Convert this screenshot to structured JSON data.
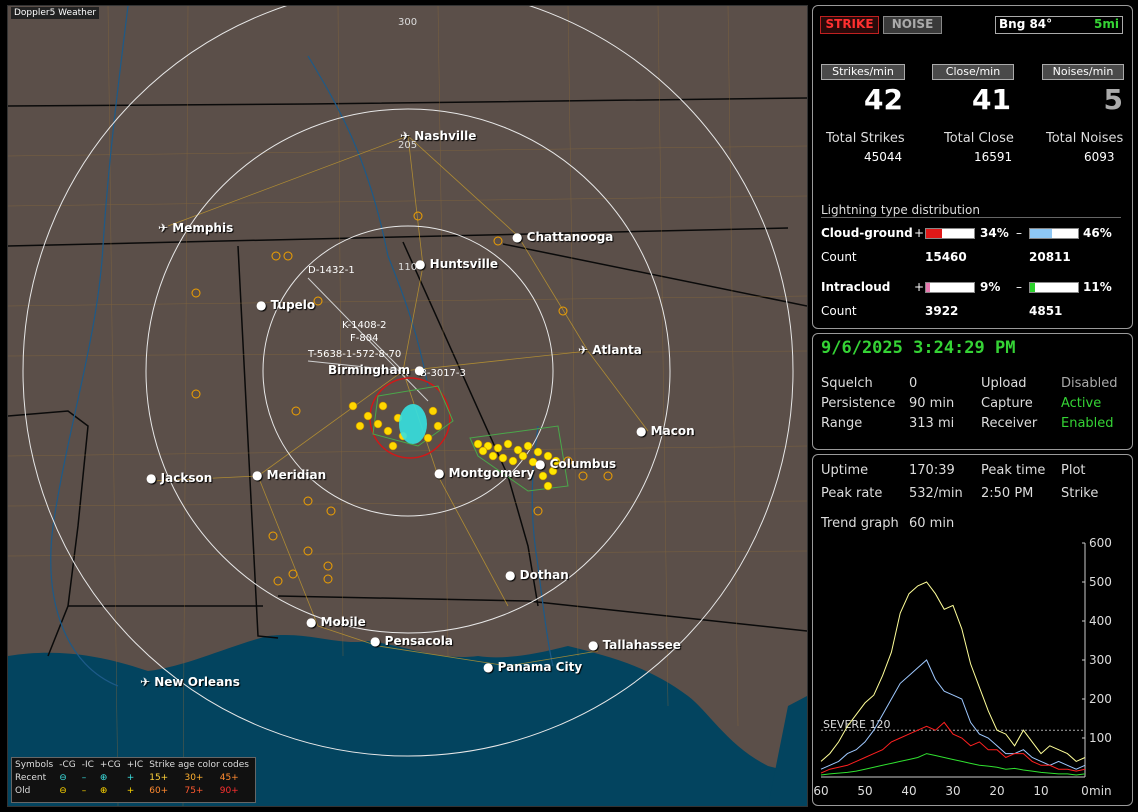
{
  "app": {
    "title": "Doppler5 Weather"
  },
  "map": {
    "ring_labels": [
      "300",
      "205",
      "110"
    ],
    "cities": [
      {
        "name": "Nashville",
        "icon": "airport-icon"
      },
      {
        "name": "Memphis",
        "icon": "airport-icon"
      },
      {
        "name": "Chattanooga",
        "icon": "city-dot-icon"
      },
      {
        "name": "Huntsville",
        "icon": "city-dot-icon"
      },
      {
        "name": "Tupelo",
        "icon": "city-dot-icon"
      },
      {
        "name": "Atlanta",
        "icon": "airport-icon"
      },
      {
        "name": "Birmingham",
        "icon": "city-dot-icon"
      },
      {
        "name": "Macon",
        "icon": "city-dot-icon"
      },
      {
        "name": "Jackson",
        "icon": "city-dot-icon"
      },
      {
        "name": "Meridian",
        "icon": "city-dot-icon"
      },
      {
        "name": "Montgomery",
        "icon": "city-dot-icon"
      },
      {
        "name": "Columbus",
        "icon": "city-dot-icon"
      },
      {
        "name": "Dothan",
        "icon": "city-dot-icon"
      },
      {
        "name": "Mobile",
        "icon": "city-dot-icon"
      },
      {
        "name": "Pensacola",
        "icon": "city-dot-icon"
      },
      {
        "name": "Tallahassee",
        "icon": "city-dot-icon"
      },
      {
        "name": "Panama City",
        "icon": "city-dot-icon"
      },
      {
        "name": "New Orleans",
        "icon": "airport-icon"
      }
    ],
    "sensors": [
      "D-1432-1",
      "K-1408-2",
      "F-804",
      "T-5638-1-572-8-70",
      "B-3017-3"
    ],
    "legend": {
      "header": [
        "Symbols",
        "-CG",
        "-IC",
        "+CG",
        "+IC",
        "Strike age color codes"
      ],
      "recent": {
        "label": "Recent",
        "ages": [
          "15+",
          "30+",
          "45+"
        ]
      },
      "old": {
        "label": "Old",
        "ages": [
          "60+",
          "75+",
          "90+"
        ]
      }
    }
  },
  "stats": {
    "strike_button": "STRIKE",
    "noise_button": "NOISE",
    "bearing": "Bng 84°",
    "range": "5mi",
    "strikes_min_label": "Strikes/min",
    "close_min_label": "Close/min",
    "noises_min_label": "Noises/min",
    "strikes_min": "42",
    "close_min": "41",
    "noises_min": "5",
    "total_strikes_label": "Total Strikes",
    "total_close_label": "Total Close",
    "total_noises_label": "Total Noises",
    "total_strikes": "45044",
    "total_close": "16591",
    "total_noises": "6093",
    "dist_title": "Lightning type distribution",
    "cg_label": "Cloud-ground",
    "ic_label": "Intracloud",
    "count_label": "Count",
    "plus": "+",
    "minus": "–",
    "cg_plus_pct": "34%",
    "cg_minus_pct": "46%",
    "cg_plus_count": "15460",
    "cg_minus_count": "20811",
    "ic_plus_pct": "9%",
    "ic_minus_pct": "11%",
    "ic_plus_count": "3922",
    "ic_minus_count": "4851",
    "cg_plus_fill": 0.34,
    "cg_minus_fill": 0.46,
    "ic_plus_fill": 0.09,
    "ic_minus_fill": 0.11,
    "colors": {
      "cg_plus": "#e01818",
      "cg_minus": "#8ec8f5",
      "ic_plus": "#e87ab0",
      "ic_minus": "#2bd12b"
    }
  },
  "status": {
    "datetime": "9/6/2025 3:24:29 PM",
    "squelch_label": "Squelch",
    "squelch": "0",
    "persistence_label": "Persistence",
    "persistence": "90 min",
    "range_label": "Range",
    "range": "313 mi",
    "upload_label": "Upload",
    "upload": "Disabled",
    "capture_label": "Capture",
    "capture": "Active",
    "receiver_label": "Receiver",
    "receiver": "Enabled"
  },
  "trend": {
    "uptime_label": "Uptime",
    "uptime": "170:39",
    "peak_time_label": "Peak time",
    "peak_time": "2:50 PM",
    "plot_label": "Plot",
    "peak_rate_label": "Peak rate",
    "peak_rate": "532/min",
    "plot_value": "Strike",
    "trend_label": "Trend graph",
    "trend_value": "60 min",
    "severe_label": "SEVERE 120"
  },
  "chart_data": {
    "type": "line",
    "x": [
      60,
      58,
      56,
      54,
      52,
      50,
      48,
      46,
      44,
      42,
      40,
      38,
      36,
      34,
      32,
      30,
      28,
      26,
      24,
      22,
      20,
      18,
      16,
      14,
      12,
      10,
      8,
      6,
      4,
      2,
      0
    ],
    "series": [
      {
        "name": "",
        "color": "#ffff99",
        "values": [
          40,
          60,
          90,
          130,
          160,
          190,
          210,
          260,
          320,
          420,
          470,
          490,
          500,
          470,
          430,
          440,
          380,
          290,
          230,
          170,
          120,
          110,
          80,
          120,
          90,
          60,
          80,
          70,
          60,
          40,
          50
        ]
      },
      {
        "name": "",
        "color": "#9ec8ff",
        "values": [
          20,
          30,
          40,
          60,
          70,
          90,
          120,
          160,
          200,
          240,
          260,
          280,
          300,
          250,
          220,
          210,
          200,
          140,
          110,
          100,
          80,
          60,
          60,
          70,
          50,
          40,
          30,
          40,
          30,
          20,
          30
        ]
      },
      {
        "name": "",
        "color": "#ff2020",
        "values": [
          10,
          20,
          25,
          30,
          40,
          50,
          60,
          70,
          90,
          100,
          110,
          120,
          130,
          120,
          140,
          110,
          100,
          80,
          90,
          70,
          70,
          50,
          60,
          60,
          40,
          30,
          30,
          20,
          20,
          15,
          20
        ]
      },
      {
        "name": "",
        "color": "#30e030",
        "values": [
          5,
          8,
          10,
          12,
          15,
          20,
          25,
          30,
          35,
          40,
          45,
          50,
          60,
          55,
          50,
          45,
          40,
          35,
          30,
          28,
          25,
          20,
          22,
          18,
          15,
          12,
          10,
          8,
          8,
          5,
          8
        ]
      }
    ],
    "severe_threshold": 120,
    "ylim": [
      0,
      600
    ],
    "yticks": [
      "100",
      "200",
      "300",
      "400",
      "500",
      "600"
    ],
    "xticks": [
      "60",
      "50",
      "40",
      "30",
      "20",
      "10",
      "0"
    ],
    "xlabel": "min"
  }
}
